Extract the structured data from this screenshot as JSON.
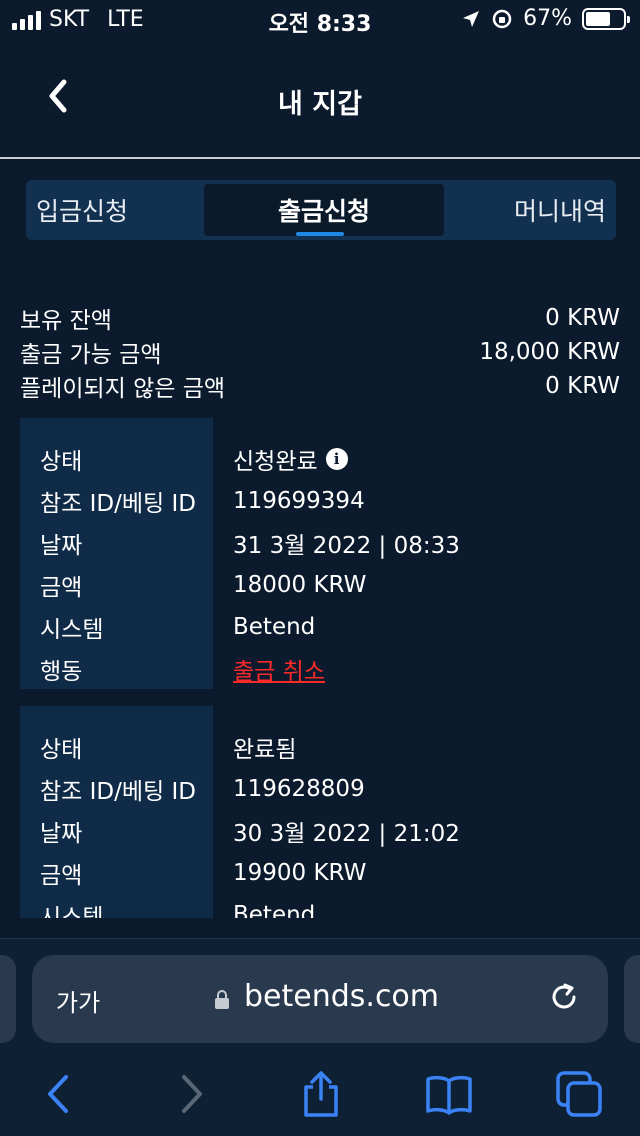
{
  "status_bar": {
    "carrier": "SKT",
    "network": "LTE",
    "time": "오전 8:33",
    "battery": "67%",
    "battery_level": 0.67
  },
  "header": {
    "title": "내 지갑",
    "back_icon": "chevron-left-icon"
  },
  "tabs": [
    {
      "label": "입금신청",
      "active": false
    },
    {
      "label": "출금신청",
      "active": true
    },
    {
      "label": "머니내역",
      "active": false
    }
  ],
  "summary": [
    {
      "label": "보유 잔액",
      "value": "0 KRW"
    },
    {
      "label": "출금 가능 금액",
      "value": "18,000 KRW"
    },
    {
      "label": "플레이되지 않은 금액",
      "value": "0 KRW"
    }
  ],
  "records": [
    {
      "status_label": "상태",
      "status_value": "신청완료",
      "ref_label": "참조 ID/베팅 ID",
      "ref_value": "119699394",
      "date_label": "날짜",
      "date_value": "31 3월 2022 | 08:33",
      "amount_label": "금액",
      "amount_value": "18000 KRW",
      "system_label": "시스템",
      "system_value": "Betend",
      "action_label": "행동",
      "action_value": "출금 취소"
    },
    {
      "status_label": "상태",
      "status_value": "완료됨",
      "ref_label": "참조 ID/베팅 ID",
      "ref_value": "119628809",
      "date_label": "날짜",
      "date_value": "30 3월 2022 | 21:02",
      "amount_label": "금액",
      "amount_value": "19900 KRW",
      "system_label": "시스템",
      "system_value": "Betend"
    }
  ],
  "browser": {
    "text_size_label": "가가",
    "domain": "betends.com"
  },
  "colors": {
    "background": "#0b1a2c",
    "tab_bar": "#12304f",
    "card": "#102b48",
    "accent": "#1e88e5",
    "link_red": "#ff2a2a",
    "ios_blue": "#3b82f6"
  }
}
